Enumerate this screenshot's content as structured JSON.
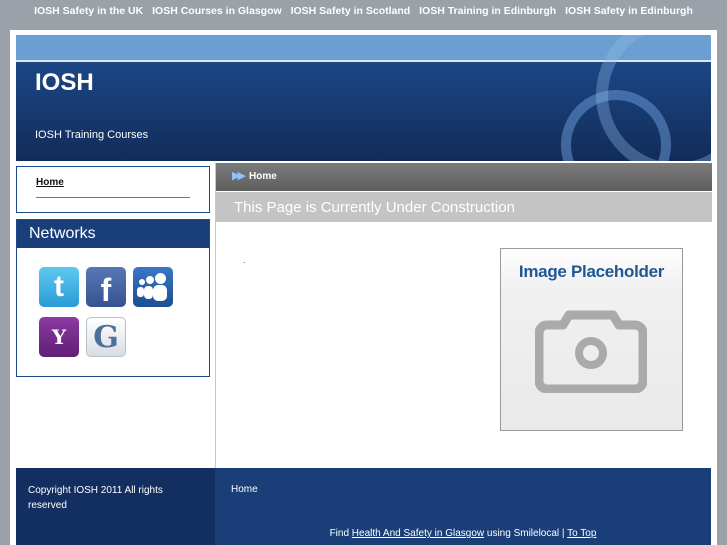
{
  "top_links": [
    "IOSH Safety in the UK",
    "IOSH Courses in Glasgow",
    "IOSH Safety in Scotland",
    "IOSH Training in Edinburgh",
    "IOSH Safety in Edinburgh"
  ],
  "header": {
    "title": "IOSH",
    "tagline": "IOSH Training Courses"
  },
  "sidebar": {
    "nav_home": "Home",
    "networks_title": "Networks",
    "networks_icons": [
      "twitter-icon",
      "facebook-icon",
      "myspace-icon",
      "yahoo-icon",
      "google-icon"
    ],
    "yahoo_glyph": "Y",
    "google_glyph": "G",
    "twitter_glyph": "t",
    "facebook_glyph": "f"
  },
  "main": {
    "breadcrumb": "Home",
    "page_title": "This Page is Currently Under Construction",
    "body_text": ".",
    "placeholder_label": "Image Placeholder"
  },
  "footer": {
    "copyright": "Copyright IOSH 2011 All rights reserved",
    "home_link": "Home",
    "find_prefix": "Find",
    "find_link": "Health And Safety in Glasgow",
    "find_mid": "using Smilelocal |",
    "top_link": "To Top"
  },
  "colors": {
    "header_blue": "#1a4380",
    "band_blue": "#6b9fd1",
    "footer_dark": "#132f61",
    "footer_blue": "#1a3f78",
    "placeholder_text": "#1f5796"
  }
}
